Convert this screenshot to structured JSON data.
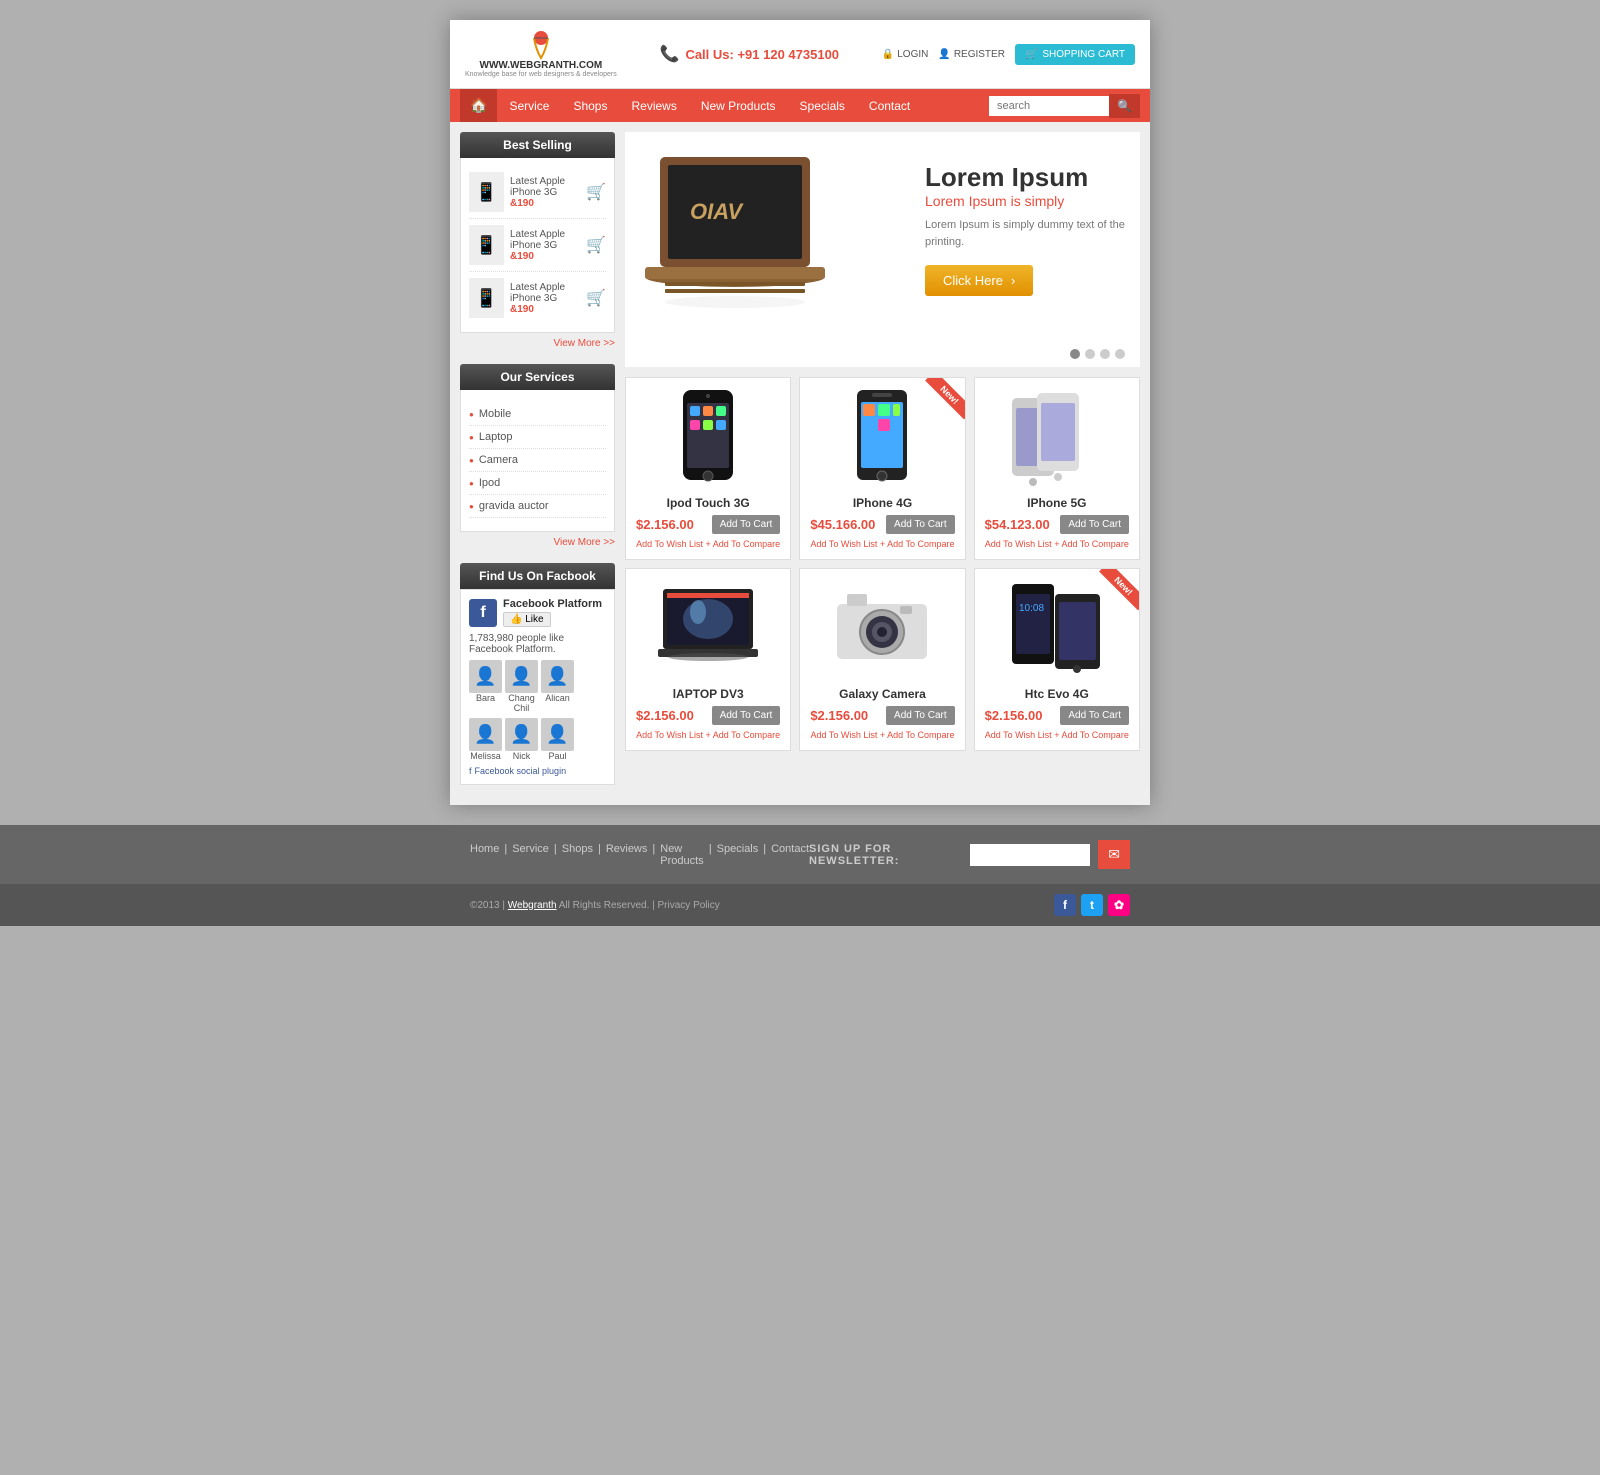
{
  "site": {
    "domain": "WWW.WEBGRANTH.COM",
    "tagline": "Knowledge base for web designers & developers",
    "phone": "Call Us: +91 120 4735100",
    "login": "LOGIN",
    "register": "REGISTER",
    "cart": "SHOPPING CART"
  },
  "nav": {
    "home_icon": "🏠",
    "items": [
      {
        "label": "Service",
        "id": "service"
      },
      {
        "label": "Shops",
        "id": "shops"
      },
      {
        "label": "Reviews",
        "id": "reviews"
      },
      {
        "label": "New Products",
        "id": "new-products"
      },
      {
        "label": "Specials",
        "id": "specials"
      },
      {
        "label": "Contact",
        "id": "contact"
      }
    ],
    "search_placeholder": "search"
  },
  "sidebar": {
    "best_selling_title": "Best Selling",
    "products": [
      {
        "name": "Latest Apple iPhone 3G",
        "price": "&190",
        "icon": "📱"
      },
      {
        "name": "Latest Apple iPhone 3G",
        "price": "&190",
        "icon": "📱"
      },
      {
        "name": "Latest Apple iPhone 3G",
        "price": "&190",
        "icon": "📱"
      }
    ],
    "view_more": "View More >>",
    "services_title": "Our Services",
    "services": [
      {
        "label": "Mobile"
      },
      {
        "label": "Laptop"
      },
      {
        "label": "Camera"
      },
      {
        "label": "Ipod"
      },
      {
        "label": "gravida auctor"
      }
    ],
    "services_view_more": "View More >>",
    "facebook_title": "Find Us On Facbook",
    "facebook_platform": "Facebook Platform",
    "fb_like": "👍 Like",
    "fb_count": "1,783,980 people like Facebook Platform.",
    "fb_persons": [
      {
        "name": "Bara"
      },
      {
        "name": "Chang Chil"
      },
      {
        "name": "Alican"
      },
      {
        "name": "Melissa"
      },
      {
        "name": "Nick"
      },
      {
        "name": "Paul"
      }
    ],
    "fb_plugin": "Facebook social plugin"
  },
  "slider": {
    "title": "Lorem Ipsum",
    "subtitle": "Lorem Ipsum is simply",
    "description": "Lorem Ipsum is simply dummy text of the printing.",
    "button": "Click Here",
    "dots": [
      true,
      false,
      false,
      false
    ]
  },
  "products": [
    {
      "id": "ipod-touch-3g",
      "name": "Ipod Touch 3G",
      "price": "$2.156.00",
      "is_new": false,
      "add_to_cart": "Add To Cart",
      "wish": "Add To Wish List",
      "compare": "+ Add To Compare",
      "icon": "📱"
    },
    {
      "id": "iphone-4g",
      "name": "IPhone 4G",
      "price": "$45.166.00",
      "is_new": true,
      "add_to_cart": "Add To Cart",
      "wish": "Add To Wish List",
      "compare": "+ Add To Compare",
      "icon": "📱"
    },
    {
      "id": "iphone-5g",
      "name": "IPhone 5G",
      "price": "$54.123.00",
      "is_new": false,
      "add_to_cart": "Add To Cart",
      "wish": "Add To Wish List",
      "compare": "+ Add To Compare",
      "icon": "📱"
    },
    {
      "id": "laptop-dv3",
      "name": "lAPTOP DV3",
      "price": "$2.156.00",
      "is_new": false,
      "add_to_cart": "Add To Cart",
      "wish": "Add To Wish List",
      "compare": "+ Add To Compare",
      "icon": "💻"
    },
    {
      "id": "galaxy-camera",
      "name": "Galaxy Camera",
      "price": "$2.156.00",
      "is_new": false,
      "add_to_cart": "Add To Cart",
      "wish": "Add To Wish List",
      "compare": "+ Add To Compare",
      "icon": "📷"
    },
    {
      "id": "htc-evo-4g",
      "name": "Htc Evo 4G",
      "price": "$2.156.00",
      "is_new": true,
      "add_to_cart": "Add To Cart",
      "wish": "Add To Wish List",
      "compare": "+ Add To Compare",
      "icon": "📱"
    }
  ],
  "footer": {
    "links": [
      "Home",
      "Service",
      "Shops",
      "Reviews",
      "New Products",
      "Specials",
      "Contact"
    ],
    "newsletter_label": "SIGN UP FOR NEWSLETTER:",
    "newsletter_placeholder": "",
    "copyright": "©2013 | Webgranth All Rights Reserved. | Privacy Policy",
    "social": [
      {
        "name": "Facebook",
        "icon": "f",
        "class": "social-fb"
      },
      {
        "name": "Twitter",
        "icon": "t",
        "class": "social-tw"
      },
      {
        "name": "Flickr",
        "icon": "✿",
        "class": "social-fl"
      }
    ]
  }
}
